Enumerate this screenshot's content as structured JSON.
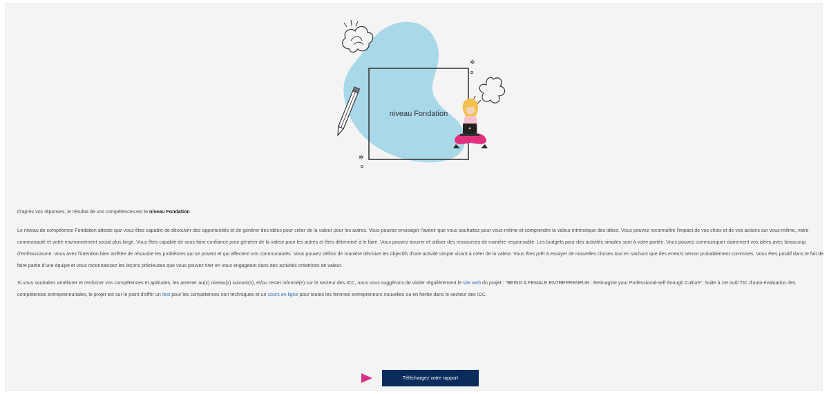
{
  "illustration": {
    "level_label": "niveau Fondation",
    "blob_color": "#a9d8e8",
    "figure_shirt_color": "#f6c1cf",
    "figure_pants_color": "#e0317f",
    "figure_hair_color": "#f2c14e"
  },
  "result": {
    "intro": "D'après vos réponses, le résultat de vos compétences est le ",
    "level_bold": "niveau Fondation"
  },
  "description": "Le niveau de compétence Fondation atteste que vous êtes capable de découvrir des opportunités et de générer des idées pour créer de la valeur pour les autres. Vous pouvez envisager l'avenir que vous souhaitez pour vous-même et comprendre la valeur intrinsèque des idées. Vous pouvez reconnaître l'impact de vos choix et de vos actions sur vous-même, votre communauté et votre environnement social plus large. Vous êtes capable de vous faire confiance pour générer de la valeur pour les autres et êtes déterminé à le faire. Vous pouvez trouver et utiliser des ressources de manière responsable. Les budgets pour des activités simples sont à votre portée. Vous pouvez communiquer clairement vos idées avec beaucoup d'enthousiasme. Vous avez l'intention bien arrêtée de résoudre les problèmes qui se posent et qui affectent vos communautés. Vous pouvez définir de manière décisive les objectifs d'une activité simple visant à créer de la valeur. Vous êtes prêt à essayer de nouvelles choses tout en sachant que des erreurs seront probablement commises. Vous êtes positif dans le fait de faire partie d'une équipe et vous reconnaissez les leçons précieuses que vous pouvez tirer en vous engageant dans des activités créatrices de valeur.",
  "recommendation": {
    "part1": "Si vous souhaitez améliorer et renforcer vos compétences et aptitudes, les amener au(x) niveau(x) suivant(s), et/ou rester informé(e) sur le secteur des ICC, nous vous suggérons de visiter régulièrement le ",
    "link_site": "site web",
    "part2": " du projet : \"BEING A FEMALE ENTREPRENEUR : Reimagine your Professional-self through Culture\". Suite à cet outil TIC d'auto-évaluation des compétences entrepreneuriales, le projet est sur le point d'offrir un ",
    "link_test": "test",
    "part3": " pour les compétences non techniques et un ",
    "link_course": "cours en ligne",
    "part4": " pour toutes les femmes entrepreneurs nouvelles ou en herbe dans le secteur des ICC."
  },
  "download": {
    "label": "Téléchargez votre rapport",
    "arrow_color": "#d63384",
    "button_color": "#0b2b5c"
  }
}
